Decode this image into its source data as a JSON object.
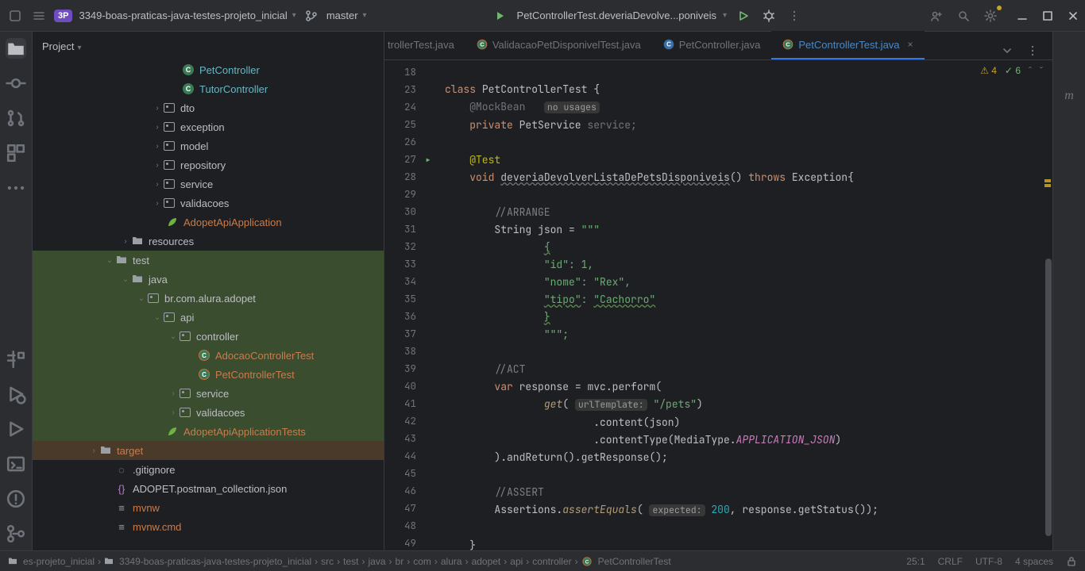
{
  "titlebar": {
    "project_badge": "3P",
    "project_name": "3349-boas-praticas-java-testes-projeto_inicial",
    "branch": "master",
    "run_config": "PetControllerTest.deveriaDevolve...poniveis"
  },
  "project_panel": {
    "title": "Project"
  },
  "tree": {
    "items": [
      {
        "pad": 174,
        "arrow": "",
        "icon": "class",
        "label": "PetController",
        "cls": "label-class"
      },
      {
        "pad": 174,
        "arrow": "",
        "icon": "class",
        "label": "TutorController",
        "cls": "label-class"
      },
      {
        "pad": 150,
        "arrow": "›",
        "icon": "pkg",
        "label": "dto"
      },
      {
        "pad": 150,
        "arrow": "›",
        "icon": "pkg",
        "label": "exception"
      },
      {
        "pad": 150,
        "arrow": "›",
        "icon": "pkg",
        "label": "model"
      },
      {
        "pad": 150,
        "arrow": "›",
        "icon": "pkg",
        "label": "repository"
      },
      {
        "pad": 150,
        "arrow": "›",
        "icon": "pkg",
        "label": "service"
      },
      {
        "pad": 150,
        "arrow": "›",
        "icon": "pkg",
        "label": "validacoes"
      },
      {
        "pad": 154,
        "arrow": "",
        "icon": "spring",
        "label": "AdopetApiApplication",
        "cls": "label-orange"
      },
      {
        "pad": 110,
        "arrow": "›",
        "icon": "dir",
        "label": "resources"
      },
      {
        "pad": 90,
        "arrow": "⌄",
        "icon": "dir",
        "label": "test",
        "hl": "hl-green"
      },
      {
        "pad": 110,
        "arrow": "⌄",
        "icon": "dir",
        "label": "java",
        "hl": "hl-green"
      },
      {
        "pad": 130,
        "arrow": "⌄",
        "icon": "pkg",
        "label": "br.com.alura.adopet",
        "hl": "hl-green"
      },
      {
        "pad": 150,
        "arrow": "⌄",
        "icon": "pkg",
        "label": "api",
        "hl": "hl-green"
      },
      {
        "pad": 170,
        "arrow": "⌄",
        "icon": "pkg",
        "label": "controller",
        "hl": "hl-green"
      },
      {
        "pad": 194,
        "arrow": "",
        "icon": "test",
        "label": "AdocaoControllerTest",
        "cls": "label-orange",
        "hl": "hl-green"
      },
      {
        "pad": 194,
        "arrow": "",
        "icon": "test",
        "label": "PetControllerTest",
        "cls": "label-orange",
        "selected": true,
        "hl": "hl-green"
      },
      {
        "pad": 170,
        "arrow": "›",
        "icon": "pkg",
        "label": "service",
        "hl": "hl-green"
      },
      {
        "pad": 170,
        "arrow": "›",
        "icon": "pkg",
        "label": "validacoes",
        "hl": "hl-green"
      },
      {
        "pad": 154,
        "arrow": "",
        "icon": "spring",
        "label": "AdopetApiApplicationTests",
        "cls": "label-orange",
        "hl": "hl-green"
      },
      {
        "pad": 70,
        "arrow": "›",
        "icon": "dir",
        "label": "target",
        "cls": "label-orange",
        "hl": "hl-orange"
      },
      {
        "pad": 90,
        "arrow": "",
        "icon": "git",
        "label": ".gitignore",
        "cls": "dim-file"
      },
      {
        "pad": 90,
        "arrow": "",
        "icon": "json",
        "label": "ADOPET.postman_collection.json"
      },
      {
        "pad": 90,
        "arrow": "",
        "icon": "file",
        "label": "mvnw",
        "cls": "label-orange"
      },
      {
        "pad": 90,
        "arrow": "",
        "icon": "file",
        "label": "mvnw.cmd",
        "cls": "label-orange"
      }
    ]
  },
  "tabs": [
    {
      "label": "...trollerTest.java",
      "active": false,
      "icon": "test",
      "clipped": true
    },
    {
      "label": "ValidacaoPetDisponivelTest.java",
      "active": false,
      "icon": "test"
    },
    {
      "label": "PetController.java",
      "active": false,
      "icon": "class"
    },
    {
      "label": "PetControllerTest.java",
      "active": true,
      "icon": "test"
    }
  ],
  "inspections": {
    "warnings": "4",
    "weak": "6"
  },
  "editor": {
    "class_decl": "class ",
    "class_name": "PetControllerTest",
    "class_open": " {",
    "line23_ann": "@MockBean",
    "line23_hint": "no usages",
    "line24": {
      "kw": "private ",
      "type": "PetService",
      "rest": " service;"
    },
    "line26": "@Test",
    "line27": {
      "kw": "void ",
      "fn": "deveriaDevolverListaDePetsDisponiveis",
      "args": "()",
      "throws": " throws ",
      "exc": "Exception",
      "open": "{"
    },
    "line29": "//ARRANGE",
    "line30": {
      "type": "String",
      "name": " json ",
      "eq": "= ",
      "str": "\"\"\""
    },
    "line31": "{",
    "line32": "\"id\": 1,",
    "line33": "\"nome\": \"Rex\",",
    "line34_k": "\"tipo\"",
    "line34_m": ": ",
    "line34_v": "\"Cachorro\"",
    "line35": "}",
    "line36": "\"\"\";",
    "line38": "//ACT",
    "line39": {
      "kw": "var",
      "name": " response ",
      "eq": "= ",
      "obj": "mvc",
      "call": ".perform("
    },
    "line40": {
      "fn": "get",
      "open": "( ",
      "hint": "urlTemplate:",
      "arg": " \"/pets\"",
      "close": ")"
    },
    "line41": ".content(json)",
    "line42": {
      "pre": ".contentType(MediaType.",
      "const": "APPLICATION_JSON",
      "post": ")"
    },
    "line43": ").andReturn().getResponse();",
    "line45": "//ASSERT",
    "line46": {
      "cls": "Assertions",
      "dot": ".",
      "fn": "assertEquals",
      "open": "( ",
      "hint": "expected:",
      "num": " 200",
      "rest": ", response.getStatus());"
    },
    "line48": "}"
  },
  "gutter_lines": [
    "18",
    "23",
    "24",
    "25",
    "26",
    "27",
    "28",
    "29",
    "30",
    "31",
    "32",
    "33",
    "34",
    "35",
    "36",
    "37",
    "38",
    "39",
    "40",
    "41",
    "42",
    "43",
    "44",
    "45",
    "46",
    "47",
    "48",
    "49"
  ],
  "breadcrumbs": [
    "es-projeto_inicial",
    "3349-boas-praticas-java-testes-projeto_inicial",
    "src",
    "test",
    "java",
    "br",
    "com",
    "alura",
    "adopet",
    "api",
    "controller",
    "PetControllerTest"
  ],
  "status": {
    "pos": "25:1",
    "sep": "CRLF",
    "enc": "UTF-8",
    "indent": "4 spaces"
  }
}
